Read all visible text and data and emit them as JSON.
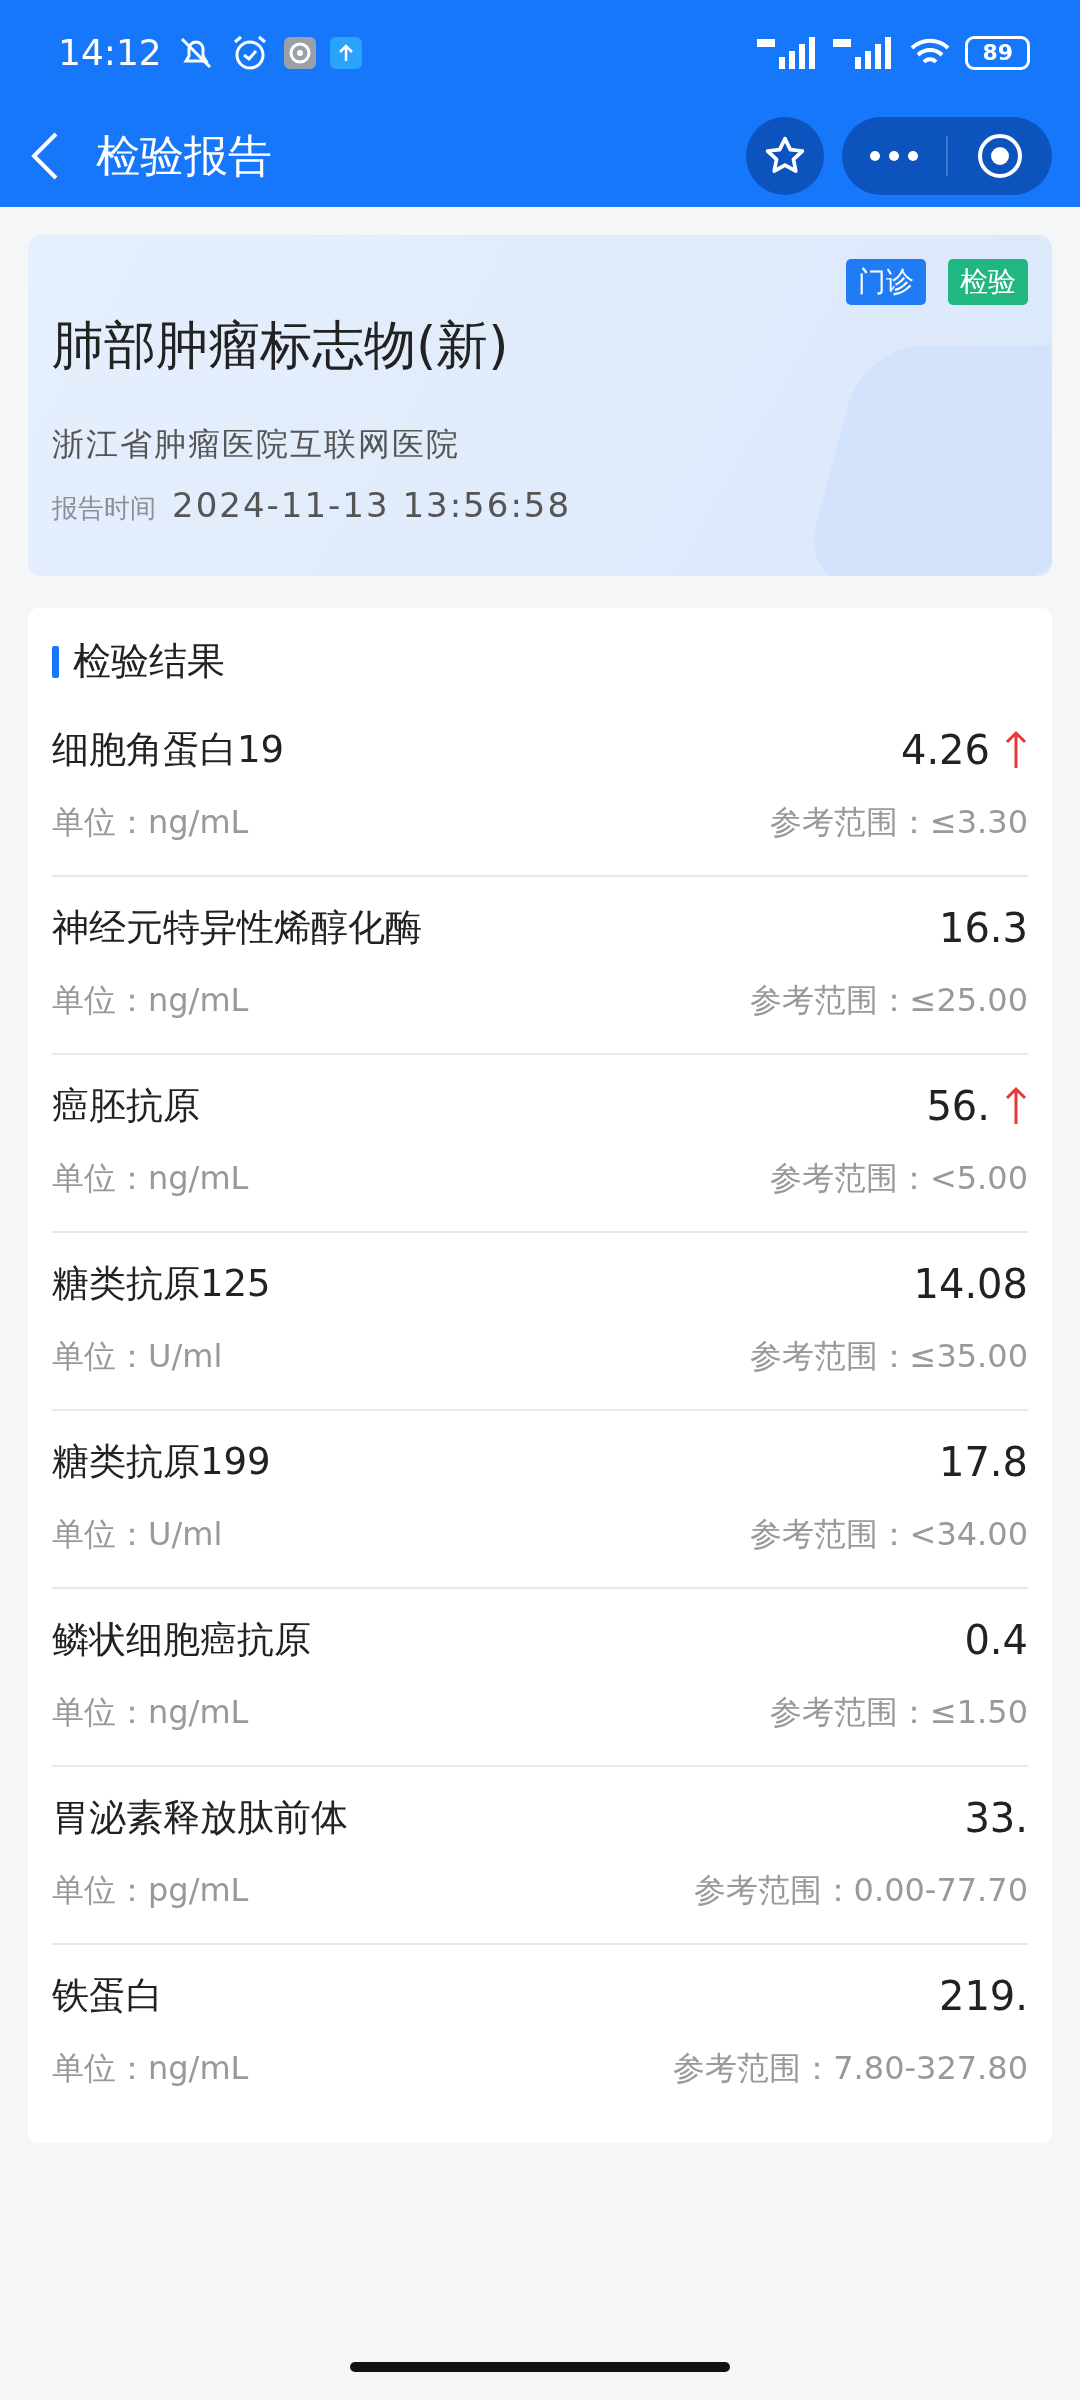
{
  "status_bar": {
    "time": "14:12",
    "battery": "89"
  },
  "header": {
    "title": "检验报告"
  },
  "report": {
    "title": "肺部肿瘤标志物(新)",
    "hospital": "浙江省肿瘤医院互联网医院",
    "time_label": "报告时间",
    "time": "2024-11-13 13:56:58",
    "tags": [
      {
        "label": "门诊",
        "color": "#1f7cf5"
      },
      {
        "label": "检验",
        "color": "#21b780"
      }
    ]
  },
  "results": {
    "title": "检验结果",
    "items": [
      {
        "name": "细胞角蛋白19",
        "value": "4.26",
        "high": true,
        "unit": "单位：ng/mL",
        "range": "参考范围：≤3.30"
      },
      {
        "name": "神经元特异性烯醇化酶",
        "value": "16.3",
        "high": false,
        "unit": "单位：ng/mL",
        "range": "参考范围：≤25.00"
      },
      {
        "name": "癌胚抗原",
        "value": "56.",
        "high": true,
        "unit": "单位：ng/mL",
        "range": "参考范围：<5.00"
      },
      {
        "name": "糖类抗原125",
        "value": "14.08",
        "high": false,
        "unit": "单位：U/ml",
        "range": "参考范围：≤35.00"
      },
      {
        "name": "糖类抗原199",
        "value": "17.8",
        "high": false,
        "unit": "单位：U/ml",
        "range": "参考范围：<34.00"
      },
      {
        "name": "鳞状细胞癌抗原",
        "value": "0.4",
        "high": false,
        "unit": "单位：ng/mL",
        "range": "参考范围：≤1.50"
      },
      {
        "name": "胃泌素释放肽前体",
        "value": "33.",
        "high": false,
        "unit": "单位：pg/mL",
        "range": "参考范围：0.00-77.70"
      },
      {
        "name": "铁蛋白",
        "value": "219.",
        "high": false,
        "unit": "单位：ng/mL",
        "range": "参考范围：7.80-327.80"
      }
    ]
  }
}
